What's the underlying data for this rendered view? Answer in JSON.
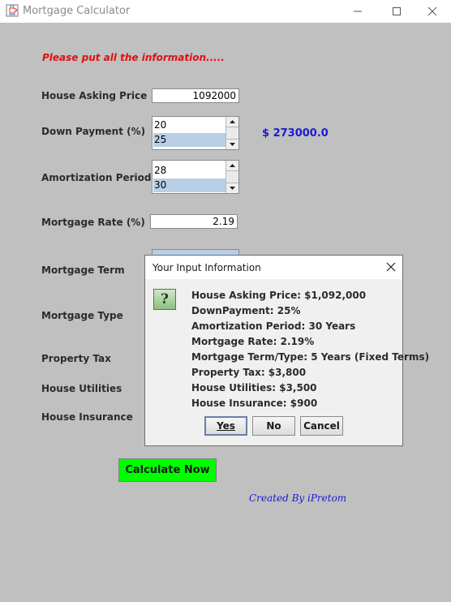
{
  "window": {
    "title": "Mortgage Calculator",
    "icon": "java-coffee-cup-icon"
  },
  "form": {
    "instruction": "Please put all the information.....",
    "house_price_label": "House Asking Price",
    "house_price_value": "1092000",
    "down_payment_label": "Down Payment (%)",
    "down_payment_options": [
      "20",
      "25"
    ],
    "down_payment_selected": "25",
    "down_payment_amount": "$ 273000.0",
    "amortization_label": "Amortization Period",
    "amortization_options": [
      "28",
      "30"
    ],
    "amortization_selected": "30",
    "mortgage_rate_label": "Mortgage Rate (%)",
    "mortgage_rate_value": "2.19",
    "mortgage_term_label": "Mortgage Term",
    "mortgage_type_label": "Mortgage Type",
    "property_tax_label": "Property Tax",
    "house_utilities_label": "House Utilities",
    "house_insurance_label": "House Insurance",
    "calculate_button": "Calculate Now",
    "credit": "Created By iPretom"
  },
  "dialog": {
    "title": "Your Input Information",
    "icon": "question-icon",
    "lines": [
      "House Asking Price:  $1,092,000",
      "DownPayment:  25%",
      "Amortization Period:  30 Years",
      "Mortgage Rate:  2.19%",
      "Mortgage Term/Type:  5 Years (Fixed Terms)",
      "Property Tax:  $3,800",
      "House Utilities:  $3,500",
      "House Insurance:  $900"
    ],
    "yes_button": "Yes",
    "no_button": "No",
    "cancel_button": "Cancel"
  },
  "colors": {
    "background": "#c0c0c0",
    "instruction": "#e01010",
    "amount": "#1a1ad4",
    "calculate_button": "#00ff00",
    "list_selection": "#b8cfe5"
  }
}
